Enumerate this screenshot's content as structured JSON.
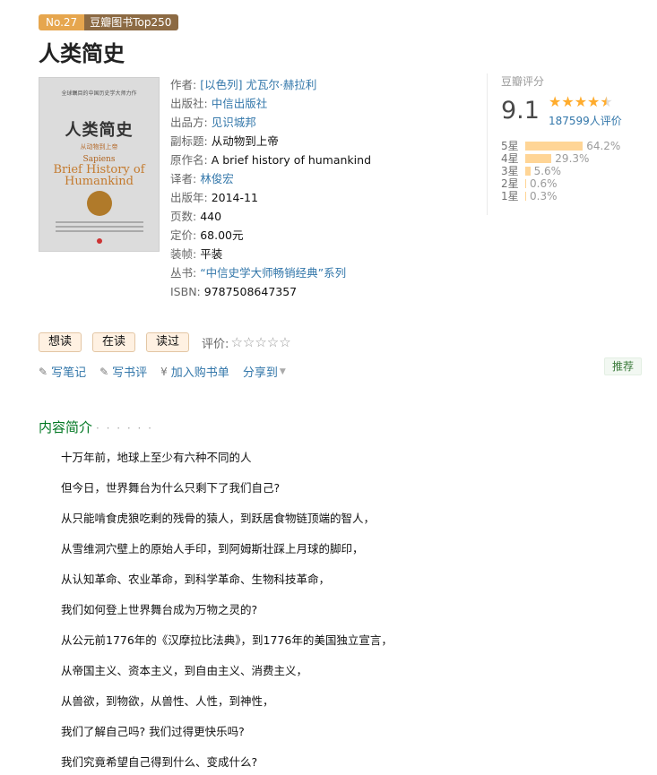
{
  "badges": {
    "rank": "No.27",
    "list": "豆瓣图书Top250"
  },
  "title": "人类简史",
  "cover": {
    "top_line": "全球瞩目的中国历史学大师力作",
    "title": "人类简史",
    "subtitle": "从动物到上帝",
    "en1": "Sapiens",
    "en2": "Brief History of Humankind"
  },
  "info": [
    {
      "label": "作者:",
      "value": "[以色列] 尤瓦尔·赫拉利",
      "link": true
    },
    {
      "label": "出版社:",
      "value": "中信出版社",
      "link": true
    },
    {
      "label": "出品方:",
      "value": "见识城邦",
      "link": true
    },
    {
      "label": "副标题:",
      "value": "从动物到上帝",
      "link": false
    },
    {
      "label": "原作名:",
      "value": "A brief history of humankind",
      "link": false
    },
    {
      "label": "译者:",
      "value": "林俊宏",
      "link": true
    },
    {
      "label": "出版年:",
      "value": "2014-11",
      "link": false
    },
    {
      "label": "页数:",
      "value": "440",
      "link": false
    },
    {
      "label": "定价:",
      "value": "68.00元",
      "link": false
    },
    {
      "label": "装帧:",
      "value": "平装",
      "link": false
    },
    {
      "label": "丛书:",
      "value": "“中信史学大师畅销经典”系列",
      "link": true
    },
    {
      "label": "ISBN:",
      "value": "9787508647357",
      "link": false
    }
  ],
  "rating": {
    "label": "豆瓣评分",
    "score": "9.1",
    "count": "187599人评价",
    "stars_value": 4.5,
    "bars": [
      {
        "label": "5星",
        "pct": "64.2%",
        "value": 64.2
      },
      {
        "label": "4星",
        "pct": "29.3%",
        "value": 29.3
      },
      {
        "label": "3星",
        "pct": "5.6%",
        "value": 5.6
      },
      {
        "label": "2星",
        "pct": "0.6%",
        "value": 0.6
      },
      {
        "label": "1星",
        "pct": "0.3%",
        "value": 0.3
      }
    ]
  },
  "actions": {
    "want": "想读",
    "reading": "在读",
    "read": "读过",
    "rate_label": "评价:"
  },
  "tools": {
    "note": "写笔记",
    "review": "写书评",
    "cart": "加入购书单",
    "share": "分享到"
  },
  "recommend": "推荐",
  "intro": {
    "heading": "内容简介",
    "dots": "· · · · · ·",
    "lines": [
      "十万年前，地球上至少有六种不同的人",
      "但今日，世界舞台为什么只剩下了我们自己?",
      "从只能啃食虎狼吃剩的残骨的猿人，到跃居食物链顶端的智人，",
      "从雪维洞穴壁上的原始人手印，到阿姆斯壮踩上月球的脚印，",
      "从认知革命、农业革命，到科学革命、生物科技革命，",
      "我们如何登上世界舞台成为万物之灵的?",
      "从公元前1776年的《汉摩拉比法典》，到1776年的美国独立宣言，",
      "从帝国主义、资本主义，到自由主义、消费主义，",
      "从兽欲，到物欲，从兽性、人性，到神性，",
      "我们了解自己吗? 我们过得更快乐吗?",
      "我们究竟希望自己得到什么、变成什么?"
    ]
  }
}
